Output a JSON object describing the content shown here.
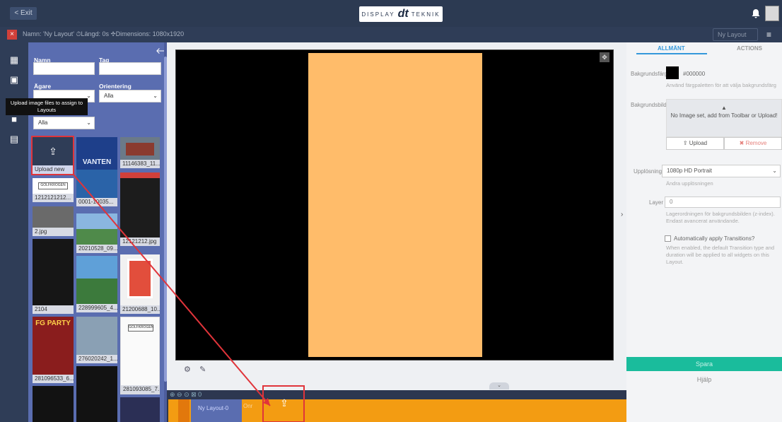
{
  "topbar": {
    "exit_label": "< Exit",
    "logo_left": "DISPLAY",
    "logo_mark": "dt",
    "logo_right": "TEKNIK"
  },
  "infobar": {
    "meta": "Namn: 'Ny Layout' ⏱Längd: 0s ✥Dimensions: 1080x1920",
    "layout_select": "Ny Layout",
    "menu_icon": "≡"
  },
  "tooltip": "Upload image files to assign to Layouts",
  "filters": {
    "name_label": "Namn",
    "tag_label": "Tag",
    "owner_label": "Ägare",
    "orientation_label": "Orientering",
    "orientation_value": "Alla",
    "third_value": "Alla"
  },
  "media": {
    "upload_label": "Upload new",
    "items": [
      {
        "caption": "11146383_11..."
      },
      {
        "caption": "1212121212..."
      },
      {
        "caption": "0001-10035..."
      },
      {
        "caption": "2.jpg"
      },
      {
        "caption": "20210528_09..."
      },
      {
        "caption": "12121212.jpg"
      },
      {
        "caption": "2104"
      },
      {
        "caption": "228999605_4..."
      },
      {
        "caption": "21200688_10..."
      },
      {
        "caption": "276020242_1..."
      },
      {
        "caption": "281096533_6..."
      },
      {
        "caption": "281093085_7..."
      }
    ]
  },
  "properties": {
    "tab_general": "ALLMÄNT",
    "tab_actions": "ACTIONS",
    "bgcolor_label": "Bakgrundsfärg",
    "bgcolor_value": "#000000",
    "bgcolor_hint": "Använd färgpaletten för att välja bakgrundsfärg",
    "bgimage_label": "Bakgrundsbild",
    "no_image": "No Image set, add from Toolbar or Upload!",
    "upload_btn": "Upload",
    "remove_btn": "Remove",
    "resolution_label": "Upplösning",
    "resolution_value": "1080p HD Portrait",
    "resolution_hint": "Ändra upplösningen",
    "layer_label": "Layer",
    "layer_value": "0",
    "layer_hint": "Lagerordningen för bakgrundsbilden (z-index). Endast avancerat användande.",
    "transitions_label": "Automatically apply Transitions?",
    "transitions_hint": "When enabled, the default Transition type and duration will be applied to all widgets on this Layout.",
    "save_btn": "Spara",
    "help_btn": "Hjälp"
  },
  "timeline": {
    "header": "⊕ ⊖ ⊙   ⊠ 0",
    "row_name": "Ny Layout-0",
    "widget_label": "Onr"
  },
  "colors": {
    "poster": "#ffbc6a",
    "library": "#5a6db0",
    "timeline_row": "#f39c12",
    "highlight": "#e0343a"
  }
}
